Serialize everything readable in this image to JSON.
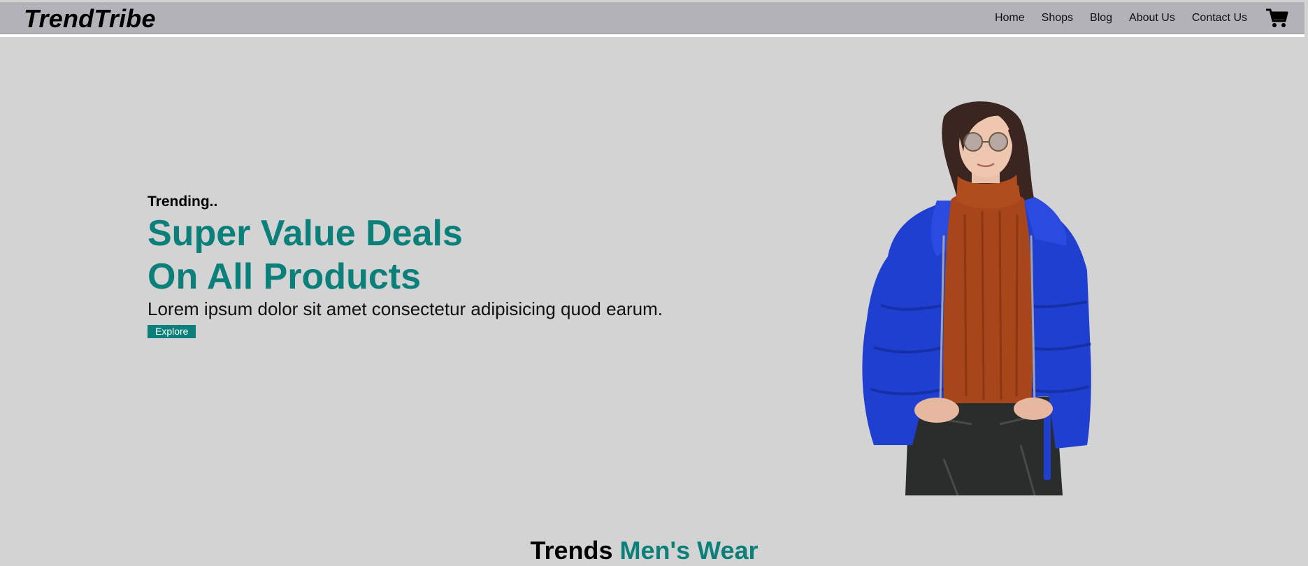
{
  "brand": {
    "logo_text": "TrendTribe"
  },
  "nav": {
    "items": [
      {
        "label": "Home"
      },
      {
        "label": "Shops"
      },
      {
        "label": "Blog"
      },
      {
        "label": "About Us"
      },
      {
        "label": "Contact Us"
      }
    ],
    "cart_icon": "shopping-cart-icon"
  },
  "hero": {
    "eyebrow": "Trending..",
    "headline_line1": "Super Value Deals",
    "headline_line2": "On All Products",
    "lede": "Lorem ipsum dolor sit amet consectetur adipisicing quod earum.",
    "cta_label": "Explore",
    "image_subject": "woman in blue puffer jacket and rust turtleneck sweater"
  },
  "section": {
    "title_plain": "Trends",
    "title_accent": "Men's Wear"
  },
  "colors": {
    "accent": "#0b7f7a",
    "page_bg": "#d3d3d3",
    "topbar_bg": "#b3b2b8"
  }
}
